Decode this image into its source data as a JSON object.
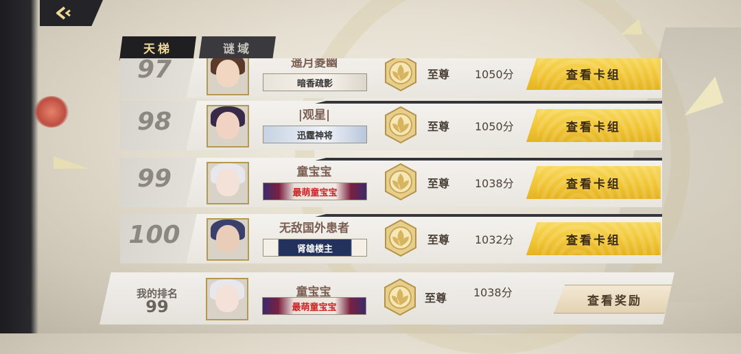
{
  "nav": {
    "back_icon": "chevron-left-icon"
  },
  "tabs": [
    {
      "label": "天梯",
      "active": true
    },
    {
      "label": "谜域",
      "active": false
    }
  ],
  "rows": [
    {
      "rank": "97",
      "name": "遥月菱幽",
      "title": "暗香疏影",
      "title_style": "plain",
      "tier": "至尊",
      "score": "1050分",
      "button": "查看卡组",
      "avatar_hair": "#5b3a2a",
      "avatar_face": "#f1d6c2"
    },
    {
      "rank": "98",
      "name": "|观星|",
      "title": "迅霆神将",
      "title_style": "blue",
      "tier": "至尊",
      "score": "1050分",
      "button": "查看卡组",
      "avatar_hair": "#3a2a4a",
      "avatar_face": "#f0d3c3"
    },
    {
      "rank": "99",
      "name": "童宝宝",
      "title": "最萌童宝宝",
      "title_style": "red",
      "tier": "至尊",
      "score": "1038分",
      "button": "查看卡组",
      "avatar_hair": "#e8e8ec",
      "avatar_face": "#f4e2d8"
    },
    {
      "rank": "100",
      "name": "无敌国外患者",
      "title": "肾雄楼主",
      "title_style": "dark",
      "tier": "至尊",
      "score": "1032分",
      "button": "查看卡组",
      "avatar_hair": "#3b3f6b",
      "avatar_face": "#e9cdb8"
    }
  ],
  "my_rank": {
    "label": "我的排名",
    "rank": "99",
    "name": "童宝宝",
    "title": "最萌童宝宝",
    "tier": "至尊",
    "score": "1038分",
    "button": "查看奖励"
  },
  "colors": {
    "gold_button": "#f0c434",
    "rank_text": "#8c8782",
    "name_text": "#7b5e52",
    "tab_active_text": "#f0d998"
  }
}
